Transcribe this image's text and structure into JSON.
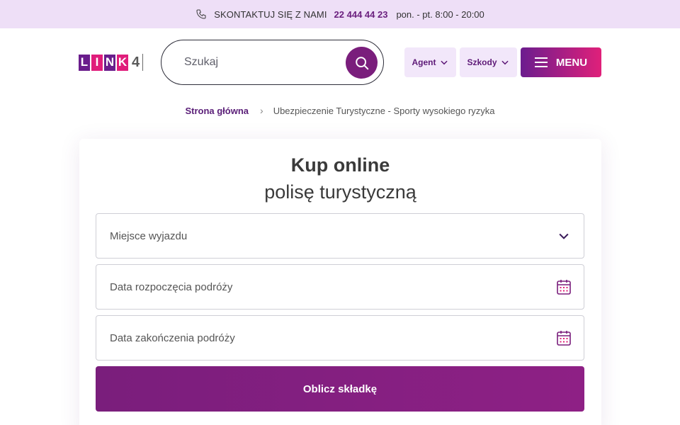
{
  "topbar": {
    "contact_label": "SKONTAKTUJ SIĘ Z NAMI",
    "phone_number": "22 444 44 23",
    "hours": "pon. - pt. 8:00 - 20:00"
  },
  "logo": {
    "letters": [
      "L",
      "I",
      "N",
      "K"
    ],
    "letter_colors": [
      "#6a1d8c",
      "#e01d7b",
      "#6a1d8c",
      "#e01d7b"
    ],
    "digit": "4"
  },
  "search": {
    "placeholder": "Szukaj"
  },
  "nav": {
    "agent_label": "Agent",
    "claims_label": "Szkody",
    "menu_label": "MENU"
  },
  "breadcrumb": {
    "home": "Strona główna",
    "separator": "›",
    "current": "Ubezpieczenie Turystyczne - Sporty wysokiego ryzyka"
  },
  "form": {
    "title": "Kup online",
    "subtitle": "polisę turystyczną",
    "destination_placeholder": "Miejsce wyjazdu",
    "start_date_placeholder": "Data rozpoczęcia podróży",
    "end_date_placeholder": "Data zakończenia podróży",
    "submit_label": "Oblicz składkę"
  },
  "colors": {
    "brand_purple": "#7a1e7c",
    "brand_pink": "#e0207a",
    "topbar_bg": "#eedff7"
  }
}
